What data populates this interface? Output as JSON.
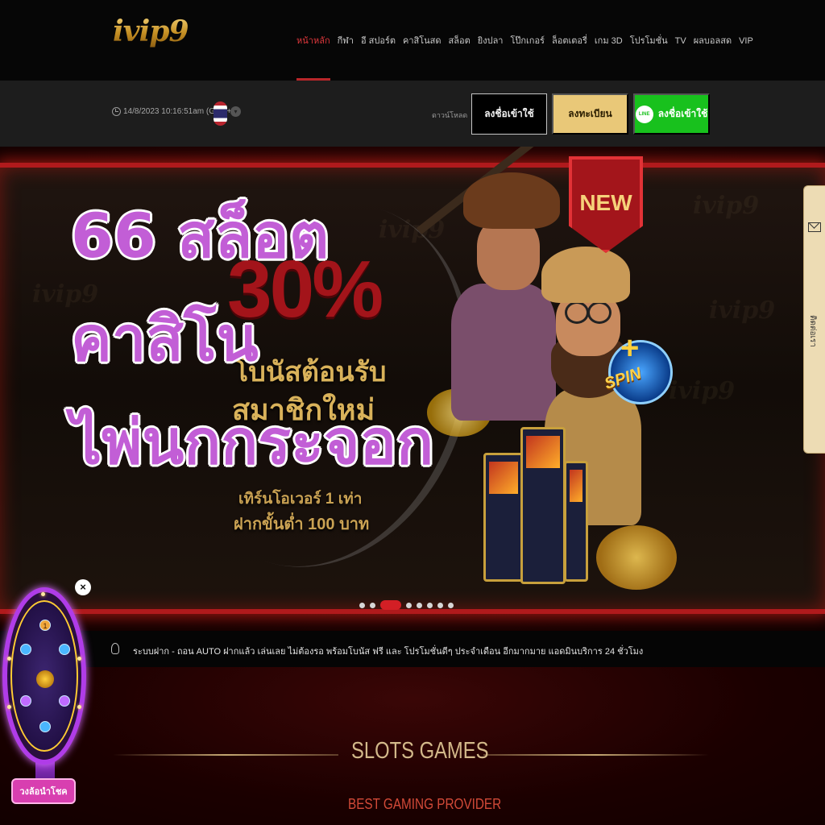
{
  "brand": {
    "logo": "ivip9"
  },
  "nav": {
    "items": [
      {
        "label": "หน้าหลัก",
        "active": true
      },
      {
        "label": "กีฬา"
      },
      {
        "label": "อี สปอร์ต"
      },
      {
        "label": "คาสิโนสด"
      },
      {
        "label": "สล็อต"
      },
      {
        "label": "ยิงปลา"
      },
      {
        "label": "โป๊กเกอร์"
      },
      {
        "label": "ล็อตเตอรี่"
      },
      {
        "label": "เกม 3D"
      },
      {
        "label": "โปรโมชั่น"
      },
      {
        "label": "TV"
      },
      {
        "label": "ผลบอลสด"
      },
      {
        "label": "VIP"
      }
    ]
  },
  "infobar": {
    "datetime": "14/8/2023 10:16:51am (GMT+8)",
    "download_label": "ดาวน์โหลด",
    "login_label": "ลงชื่อเข้าใช้",
    "register_label": "ลงทะเบียน",
    "line_icon_text": "LINE",
    "line_login_label": "ลงชื่อเข้าใช้"
  },
  "hero": {
    "badge_new": "NEW",
    "promo_percent": "30%",
    "promo_line1": "โบนัสต้อนรับ",
    "promo_line2": "สมาชิกใหม่",
    "promo_line3": "เทิร์นโอเวอร์ 1 เท่า",
    "promo_line4": "ฝากขั้นต่ำ 100 บาท",
    "spin_badge": "SPIN",
    "spin_plus": "+",
    "watermark": "ivip9",
    "slides_total": 8,
    "active_slide": 3
  },
  "overlay_title": {
    "line1": "66 สล็อต",
    "line2": "คาสิโน",
    "line3": "ไพ่นกกระจอก"
  },
  "side_tab": {
    "label": "ติดต่อเรา"
  },
  "announcement": {
    "text": "ระบบฝาก - ถอน AUTO ฝากแล้ว เล่นเลย ไม่ต้องรอ พร้อมโบนัส ฟรี และ โปรโมชั่นดีๆ ประจำเดือน อีกมากมาย แอดมินบริการ 24 ชั่วโมง"
  },
  "section": {
    "title": "SLOTS GAMES",
    "subtitle": "BEST GAMING PROVIDER"
  },
  "lucky_wheel": {
    "close_label": "×",
    "button_label": "วงล้อนำโชค",
    "segment_marker": "1"
  },
  "colors": {
    "accent_red": "#d31f25",
    "gold": "#e9c878",
    "line_green": "#18c11d",
    "overlay_purple": "#c25ed6"
  }
}
